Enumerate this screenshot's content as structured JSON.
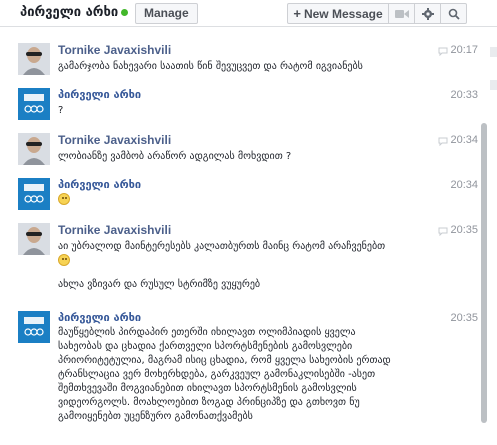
{
  "header": {
    "page_name": "პირველი არხი",
    "manage_label": "Manage",
    "new_message_label": "New Message",
    "colors": {
      "online": "#42b72a",
      "link": "#365899"
    }
  },
  "messages": [
    {
      "sender": "Tornike Javaxishvili",
      "time": "20:17",
      "text": "გამარჯობა ნახევარი საათის წინ შევუცვეთ და რატომ იგვიანებს",
      "avatar": "user"
    },
    {
      "sender": "პირველი არხი",
      "time": "20:33",
      "text": "?",
      "avatar": "page"
    },
    {
      "sender": "Tornike Javaxishvili",
      "time": "20:34",
      "text": "ლობიანზე ვამბობ არაწორ ადგილას მოხვდით ?",
      "avatar": "user"
    },
    {
      "sender": "პირველი არხი",
      "time": "20:34",
      "text": "",
      "emoji": "smile-emoji",
      "avatar": "page"
    },
    {
      "sender": "Tornike Javaxishvili",
      "time": "20:35",
      "text": "აი უბრალოდ მაინტერესებს კალათბურთს მაინც რატომ არაჩვენებთ",
      "text2": "ახლა ვზივარ და რუსულ სტრიმზე ვუყურებ",
      "emoji": "smile-emoji",
      "avatar": "user"
    },
    {
      "sender": "პირველი არხი",
      "time": "20:35",
      "lines": [
        "მაუწყებლის პირდაპირ ეთერში იხილავთ ოლიმპიადის ყველა",
        "სახეობას და ცხადია ქართველი სპორტსმენების გამოსვლები",
        "პრიორიტეტულია, მაგრამ ისიც ცხადია, რომ ყველა სახეობის ერთად",
        "ტრანსლაცია ვერ მოხერხდება, გარკვეულ გამონაკლისებში -ასეთ",
        "შემთხვევაში  მოგვიანებით იხილავთ სპორტსმენის გამოსვლის",
        "ვიდეორგოლს. მოახლოებით ზოგად პრინციპზე და გთხოვთ ნუ",
        "გამოიყენებთ უცენზურო გამონათქვამებს"
      ],
      "avatar": "page"
    }
  ],
  "icons": [
    "plus-icon",
    "video-camera-icon",
    "gear-icon",
    "search-icon",
    "reply-icon",
    "smile-emoji"
  ]
}
